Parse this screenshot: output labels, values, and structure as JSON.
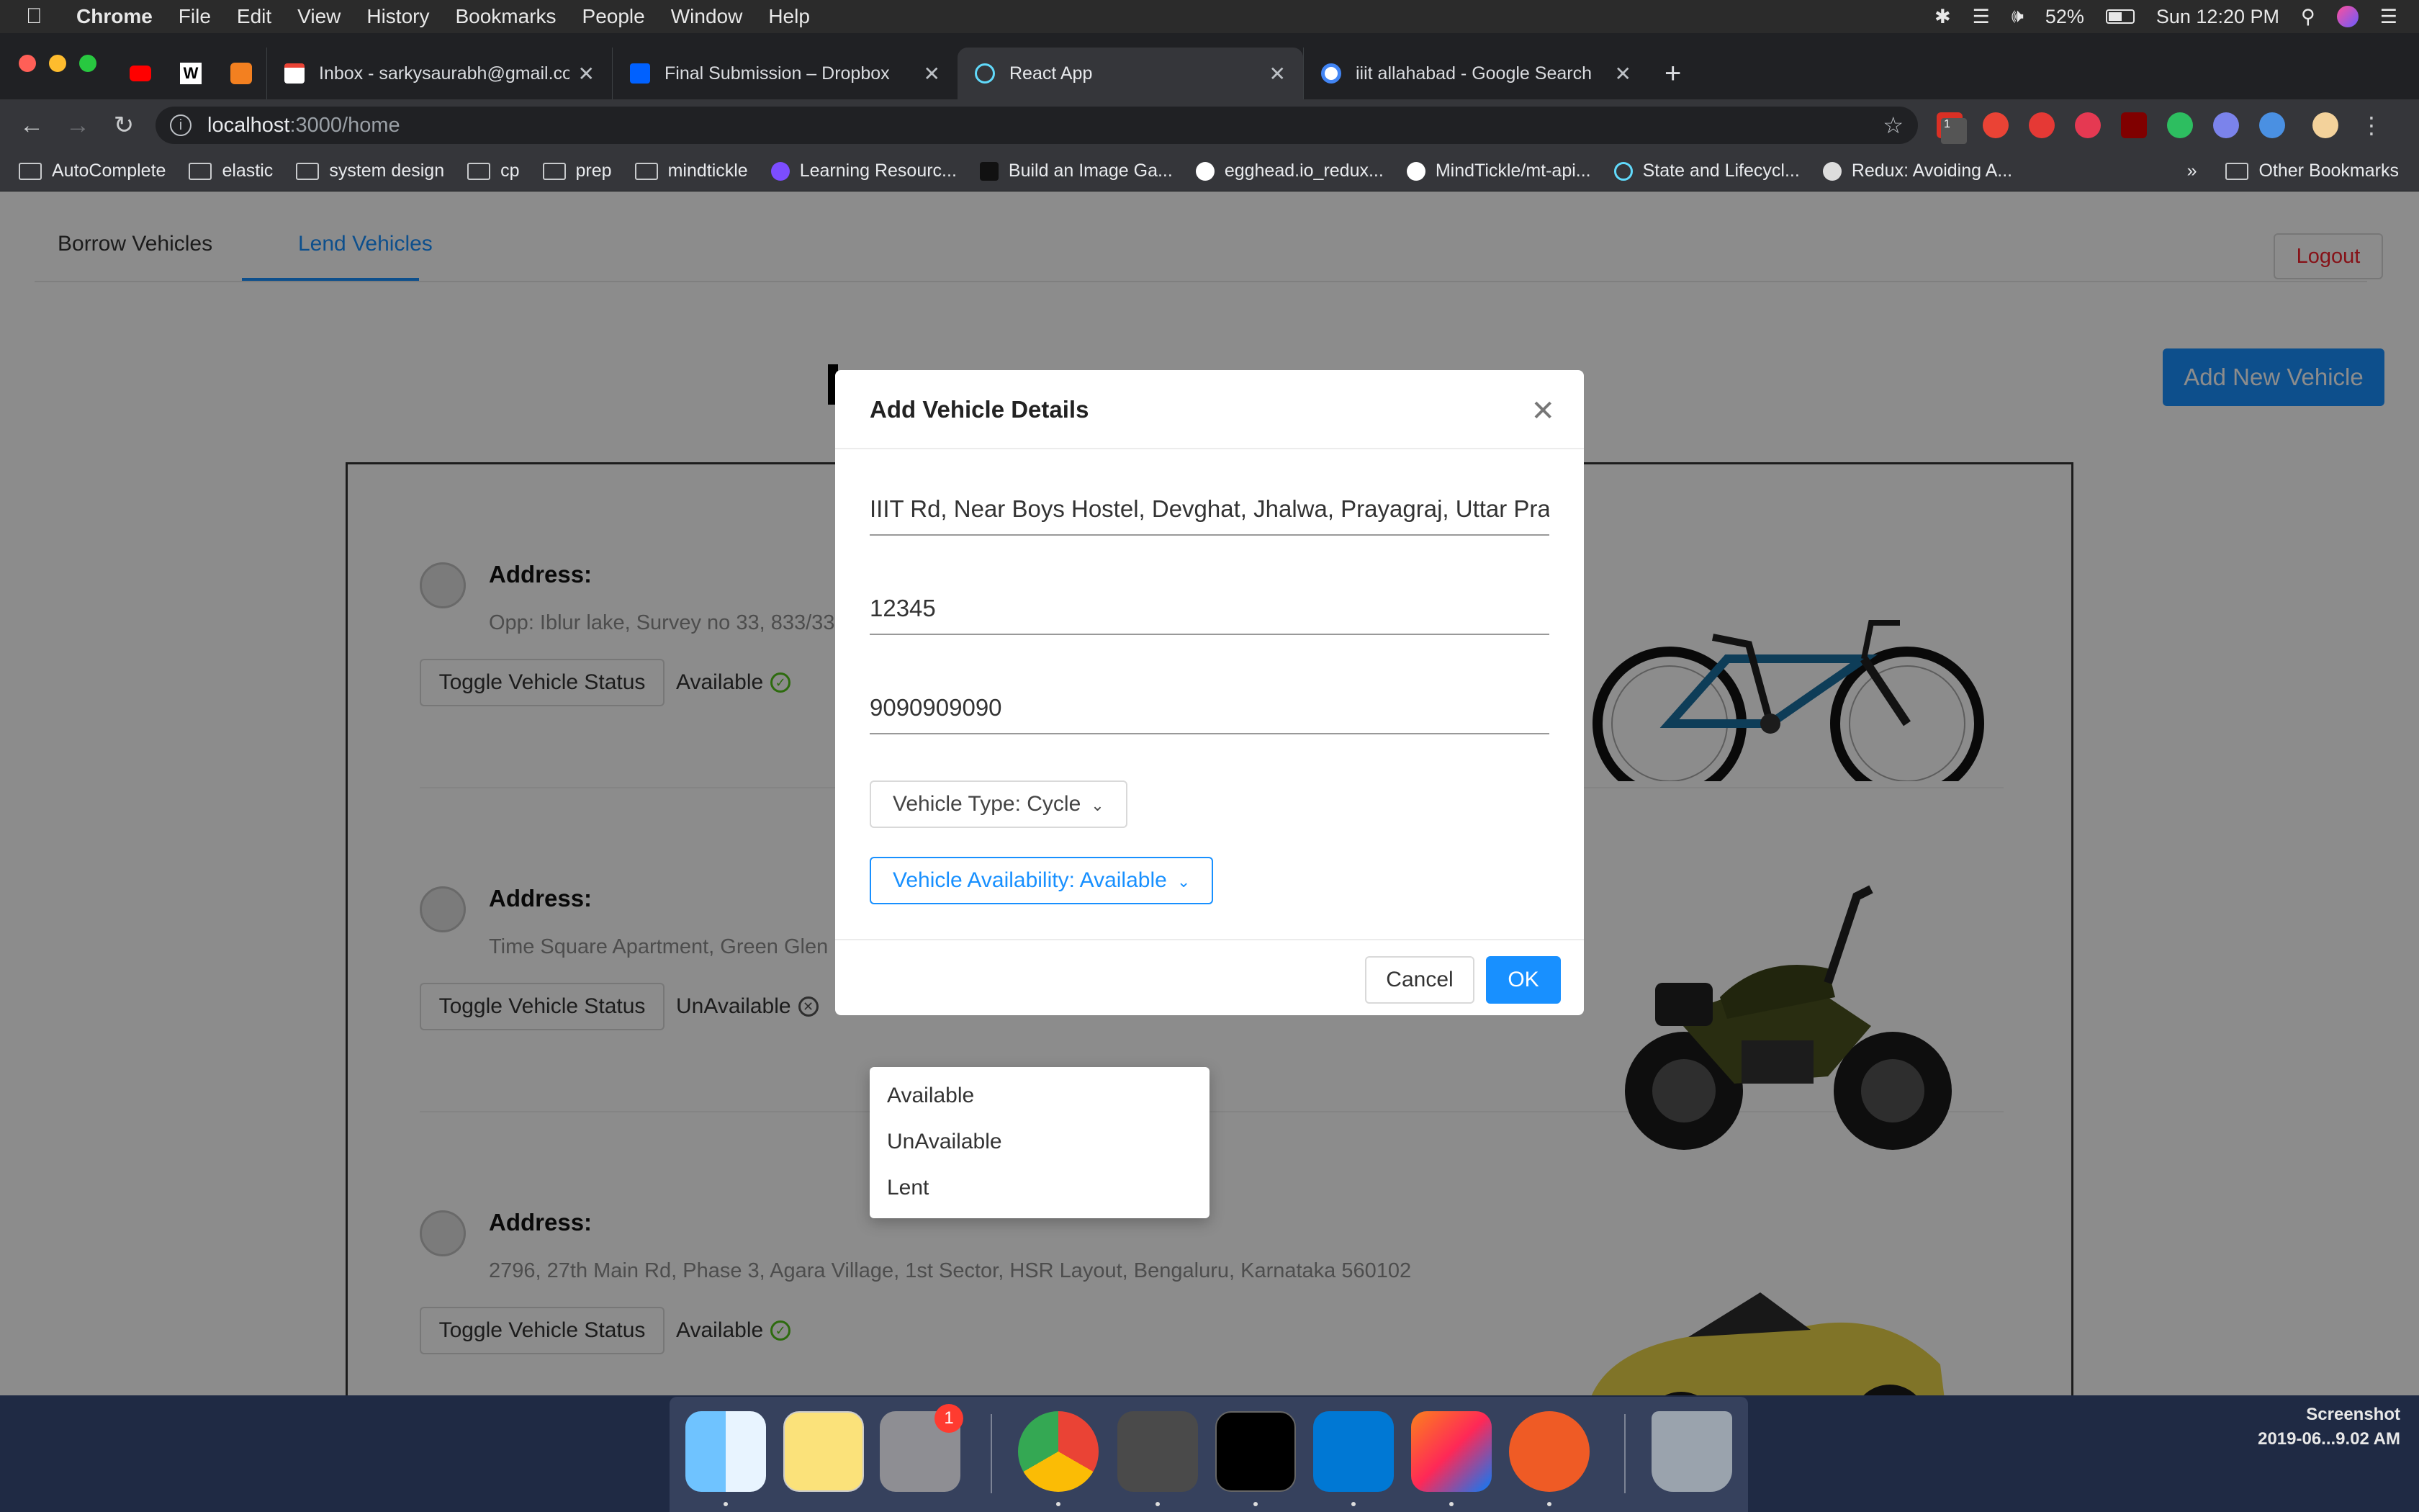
{
  "menubar": {
    "app": "Chrome",
    "items": [
      "File",
      "Edit",
      "View",
      "History",
      "Bookmarks",
      "People",
      "Window",
      "Help"
    ],
    "battery": "52%",
    "clock": "Sun 12:20 PM"
  },
  "browser": {
    "tabs": [
      {
        "title": "Inbox - sarkysaurabh@gmail.com",
        "favicon_color": "#ffffff"
      },
      {
        "title": "Final Submission – Dropbox",
        "favicon_color": "#0061ff"
      },
      {
        "title": "React App",
        "favicon_color": "#61dafb"
      },
      {
        "title": "iiit allahabad - Google Search",
        "favicon_color": "#ffffff"
      }
    ],
    "url_host": "localhost",
    "url_path": ":3000/home",
    "bookmarks": [
      "AutoComplete",
      "elastic",
      "system design",
      "cp",
      "prep",
      "mindtickle",
      "Learning Resourc...",
      "Build an Image Ga...",
      "egghead.io_redux...",
      "MindTickle/mt-api...",
      "State and Lifecycl...",
      "Redux: Avoiding A..."
    ],
    "bookmarks_more": "»",
    "other_bookmarks": "Other Bookmarks",
    "ext_badge": "1"
  },
  "app": {
    "tabs": {
      "borrow": "Borrow Vehicles",
      "lend": "Lend Vehicles"
    },
    "logout": "Logout",
    "add_new": "Add New Vehicle",
    "vehicles": [
      {
        "addr_label": "Address:",
        "address": "Opp: Iblur lake, Survey no 33, 833/33",
        "toggle": "Toggle Vehicle Status",
        "status": "Available",
        "image": "bicycle"
      },
      {
        "addr_label": "Address:",
        "address": "Time Square Apartment, Green Glen L",
        "toggle": "Toggle Vehicle Status",
        "status": "UnAvailable",
        "image": "motorcycle"
      },
      {
        "addr_label": "Address:",
        "address": "2796, 27th Main Rd, Phase 3, Agara Village, 1st Sector, HSR Layout, Bengaluru, Karnataka 560102",
        "toggle": "Toggle Vehicle Status",
        "status": "Available",
        "image": "car"
      }
    ]
  },
  "modal": {
    "title": "Add Vehicle Details",
    "address_value": "IIIT Rd, Near Boys Hostel, Devghat, Jhalwa, Prayagraj, Uttar Pradesh",
    "pincode_value": "12345",
    "phone_value": "9090909090",
    "vehicle_type": "Vehicle Type: Cycle",
    "vehicle_availability": "Vehicle Availability: Available",
    "availability_options": [
      "Available",
      "UnAvailable",
      "Lent"
    ],
    "cancel": "Cancel",
    "ok": "OK"
  },
  "dock": {
    "badge": "1",
    "screenshot_label": "Screenshot",
    "screenshot_date": "2019-06...9.02 AM"
  }
}
